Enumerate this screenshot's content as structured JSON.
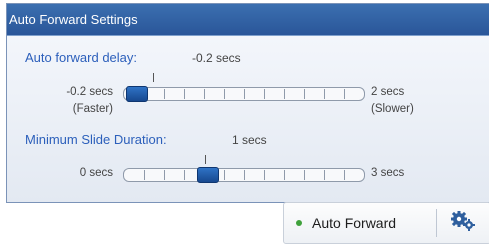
{
  "panel": {
    "title": "Auto Forward Settings"
  },
  "delay": {
    "label": "Auto forward delay:",
    "value": "-0.2 secs",
    "min_label": "-0.2 secs",
    "min_hint": "(Faster)",
    "max_label": "2 secs",
    "max_hint": "(Slower)",
    "position_fraction": 0.0
  },
  "min_duration": {
    "label": "Minimum Slide Duration:",
    "value": "1 secs",
    "min_label": "0 secs",
    "max_label": "3 secs",
    "position_fraction": 0.33
  },
  "footer": {
    "auto_forward_label": "Auto Forward",
    "status_color": "#3fa13b",
    "settings_icon": "gears-icon"
  }
}
